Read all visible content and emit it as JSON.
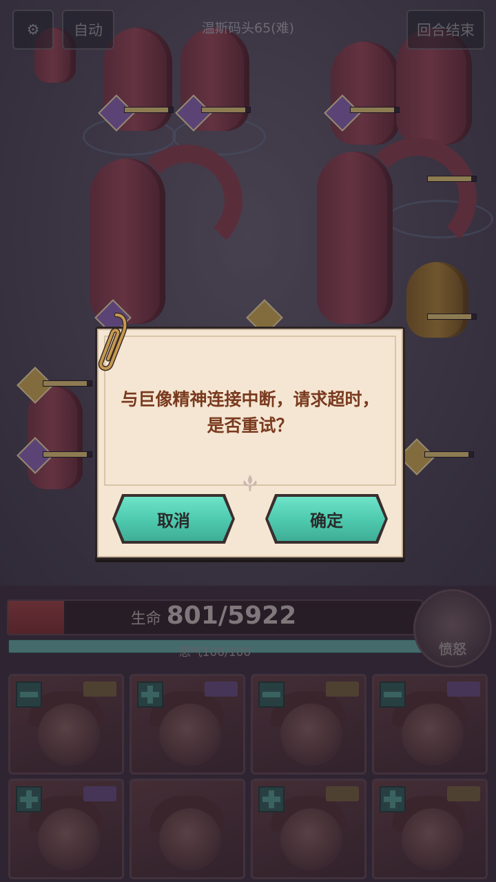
{
  "header": {
    "settings_icon": "gear-icon",
    "auto_label": "自动",
    "stage_title": "温斯码头65(难)",
    "end_turn_label": "回合结束"
  },
  "battle": {
    "hp_label": "生命",
    "hp_value": "801/5922",
    "hp_fraction": 0.135,
    "rage_label": "怒气100/100",
    "rage_fraction": 1.0,
    "rage_button_label": "愤怒"
  },
  "party": {
    "cards": [
      {
        "name": "hero-1"
      },
      {
        "name": "hero-2"
      },
      {
        "name": "hero-3"
      },
      {
        "name": "hero-4"
      },
      {
        "name": "hero-5"
      },
      {
        "name": "hero-6"
      },
      {
        "name": "hero-7"
      },
      {
        "name": "hero-8"
      }
    ]
  },
  "dialog": {
    "message": "与巨像精神连接中断，请求超时，是否重试？",
    "cancel_label": "取消",
    "confirm_label": "确定",
    "accent_color": "#4fcbb0",
    "text_color": "#7a3a1f"
  }
}
